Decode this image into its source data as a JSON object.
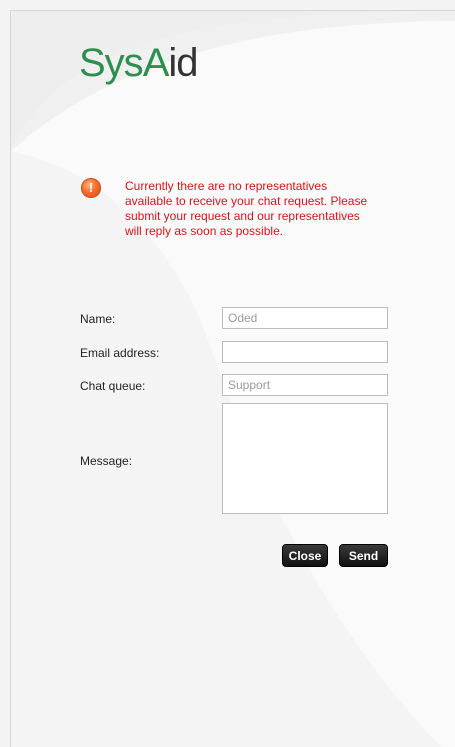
{
  "logo": {
    "prefix": "Sys",
    "accent": "A",
    "suffix": "id"
  },
  "alert": {
    "icon": "exclamation-icon",
    "message": "Currently there are no representatives available to receive your chat request. Please submit your request and our representatives will reply as soon as possible.",
    "color": "#d4141a"
  },
  "form": {
    "name_label": "Name:",
    "name_value": "Oded",
    "email_label": "Email address:",
    "email_value": "",
    "queue_label": "Chat queue:",
    "queue_value": "Support",
    "message_label": "Message:",
    "message_value": ""
  },
  "buttons": {
    "close_label": "Close",
    "send_label": "Send"
  },
  "colors": {
    "brand_green": "#2d8f4e",
    "button_dark": "#1a1a1a"
  }
}
